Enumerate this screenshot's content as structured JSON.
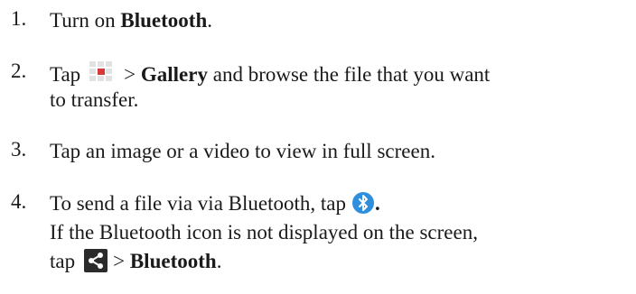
{
  "steps": [
    {
      "number": "1.",
      "t1": "Turn on ",
      "t1_bold": "Bluetooth",
      "t1_end": "."
    },
    {
      "number": "2.",
      "t1": "Tap",
      "icon": "apps-grid-icon",
      "t2": "> ",
      "t2_bold": "Gallery",
      "t3": " and browse the file that you want",
      "t4": "to transfer."
    },
    {
      "number": "3.",
      "t1": "Tap an image or a video to view in full screen."
    },
    {
      "number": "4.",
      "t1": "To send a file via via Bluetooth, tap",
      "icon": "bluetooth-icon",
      "t1_end": ".",
      "t2": "If the Bluetooth icon is not displayed on the screen,",
      "t3": "tap",
      "icon2": "share-icon",
      "t4": "> ",
      "t4_bold": "Bluetooth",
      "t4_end": "."
    }
  ],
  "colors": {
    "text": "#1a1a1a",
    "bluetooth_blue": "#2f8fdc",
    "apps_red": "#d83a3a",
    "apps_grey": "#d8d8d8",
    "share_bg": "#2b2b2b"
  }
}
